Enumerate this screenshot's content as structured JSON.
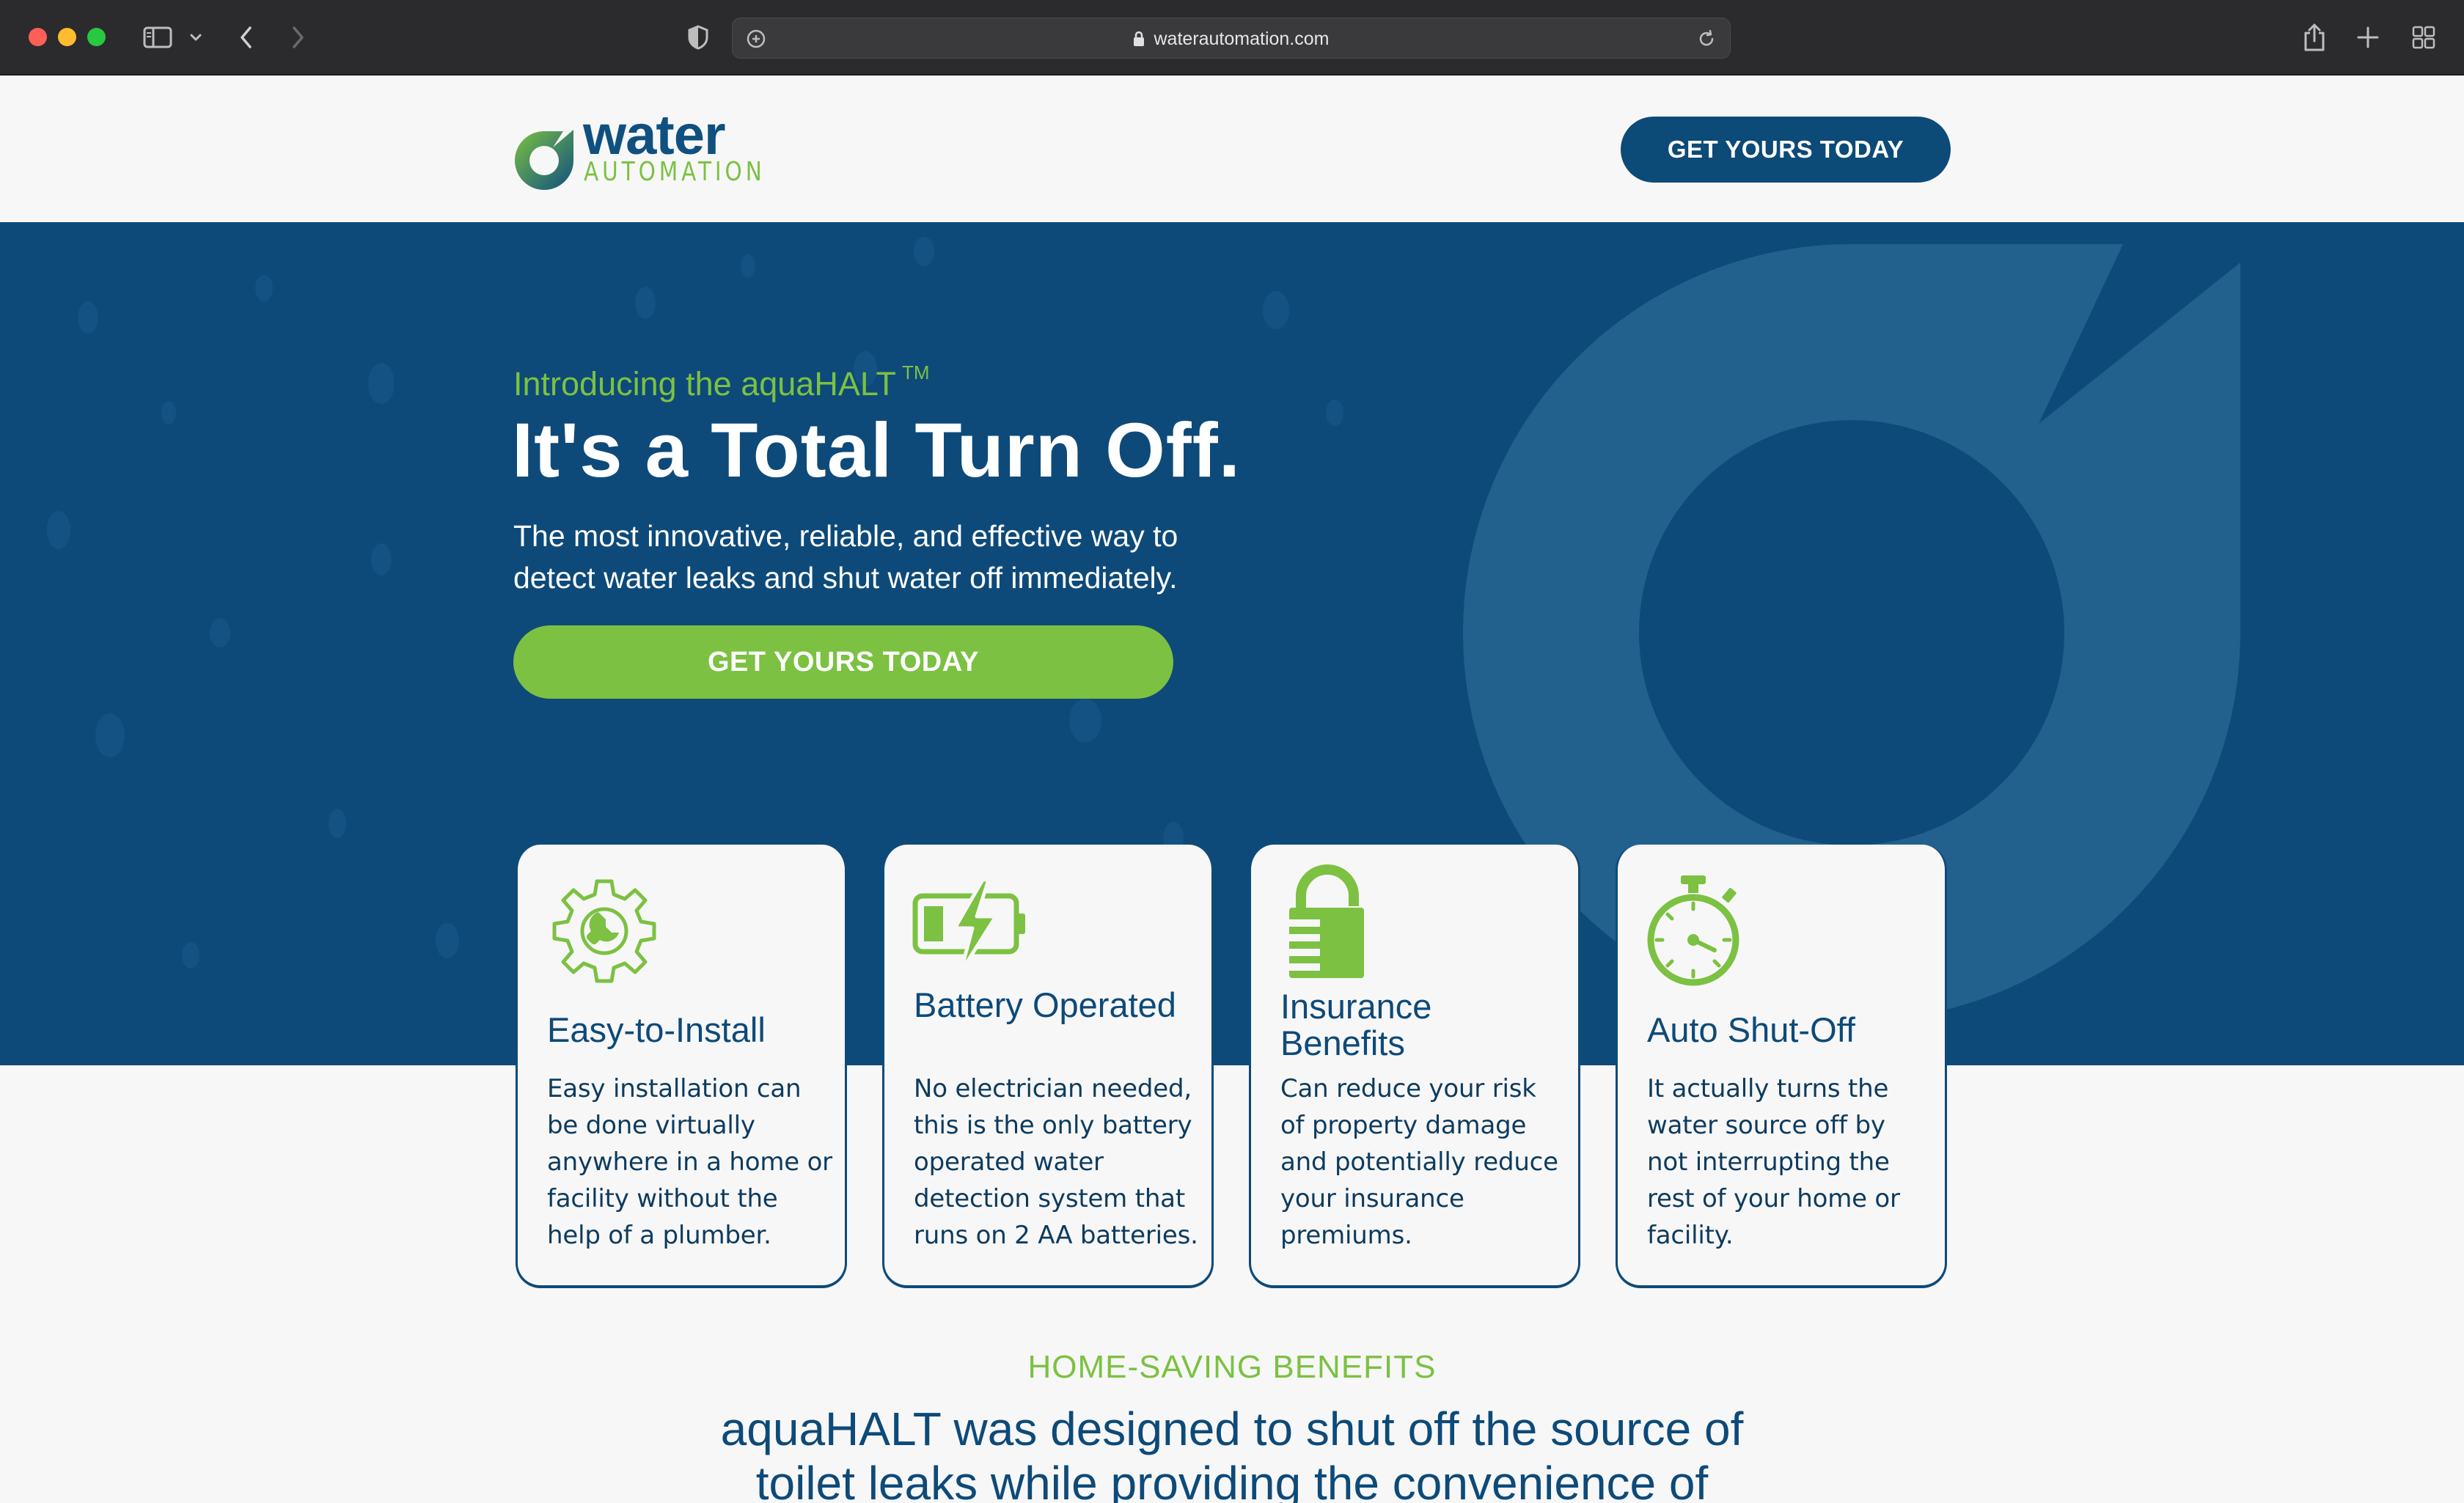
{
  "browser": {
    "url": "waterautomation.com",
    "icons": {
      "sidebar": "sidebar-icon",
      "back": "chevron-left-icon",
      "forward": "chevron-right-icon",
      "privacy": "shield-icon",
      "lock": "lock-icon",
      "reload": "reload-icon",
      "share": "share-icon",
      "new_tab": "plus-icon",
      "tab_overview": "grid-icon"
    }
  },
  "header": {
    "logo_word": "water",
    "logo_sub": "AUTOMATION",
    "cta_label": "GET YOURS TODAY"
  },
  "hero": {
    "eyebrow": "Introducing the aquaHALT",
    "trademark": "TM",
    "title": "It's a Total Turn Off.",
    "subtitle_line1": "The most innovative, reliable, and effective way to",
    "subtitle_line2": "detect water leaks and shut water off immediately.",
    "cta_label": "GET YOURS TODAY"
  },
  "features": [
    {
      "icon": "gear-wrench-icon",
      "title": "Easy-to-Install",
      "body": "Easy installation can be done virtually anywhere in a home or facility without the help of a plumber."
    },
    {
      "icon": "battery-bolt-icon",
      "title": "Battery Operated",
      "body": "No electrician needed, this is the only battery operated water detection system that runs on 2 AA batteries."
    },
    {
      "icon": "padlock-icon",
      "title_line1": "Insurance",
      "title_line2": "Benefits",
      "body": "Can reduce your risk of property damage and potentially reduce your insurance premiums."
    },
    {
      "icon": "stopwatch-icon",
      "title": "Auto Shut-Off",
      "body": "It actually turns the water source off by not interrupting the rest of your home or facility."
    }
  ],
  "benefits": {
    "eyebrow": "HOME-SAVING BENEFITS",
    "heading_line1": "aquaHALT was designed to shut off the source of",
    "heading_line2": "toilet leaks while providing the convenience of"
  },
  "colors": {
    "brand_navy": "#0d4a79",
    "brand_green": "#7cc142",
    "page_bg": "#f7f7f7"
  }
}
